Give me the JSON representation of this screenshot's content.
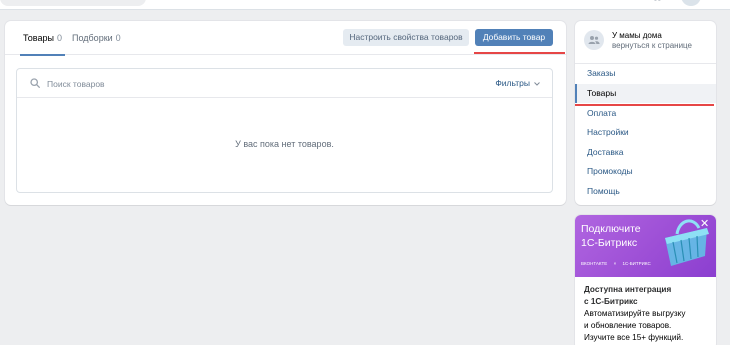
{
  "tabs": [
    {
      "label": "Товары",
      "count": "0"
    },
    {
      "label": "Подборки",
      "count": "0"
    }
  ],
  "actions": {
    "configure_label": "Настроить свойства товаров",
    "add_label": "Добавить товар"
  },
  "goods": {
    "search_placeholder": "Поиск товаров",
    "filters_label": "Фильтры",
    "empty_message": "У вас пока нет товаров."
  },
  "community": {
    "name": "У мамы дома",
    "back_label": "вернуться к странице"
  },
  "menu": [
    {
      "label": "Заказы"
    },
    {
      "label": "Товары",
      "active": true
    },
    {
      "label": "Оплата"
    },
    {
      "label": "Настройки"
    },
    {
      "label": "Доставка"
    },
    {
      "label": "Промокоды"
    },
    {
      "label": "Помощь"
    }
  ],
  "ad": {
    "headline_line1": "Подключите",
    "headline_line2": "1С-Битрикс",
    "brand_vk": "ВКОНТАКТЕ",
    "brand_separator": "×",
    "brand_bitrix": "1С-БИТРИКС",
    "title_line1": "Доступна интеграция",
    "title_line2": "с 1С-Битрикс",
    "body_line1": "Автоматизируйте выгрузку",
    "body_line2": "и обновление товаров.",
    "body_line3": "Изучите все 15+ функций.",
    "close_glyph": "✕"
  },
  "colors": {
    "accent": "#5181b8",
    "link": "#2a5885",
    "highlight_underline": "#e64646",
    "ad_background": "#9d4fd6"
  },
  "icons": {
    "search": "search-icon",
    "chevron": "chevron-down-icon",
    "community": "users-icon",
    "close": "close-icon",
    "apps": "apps-icon"
  }
}
